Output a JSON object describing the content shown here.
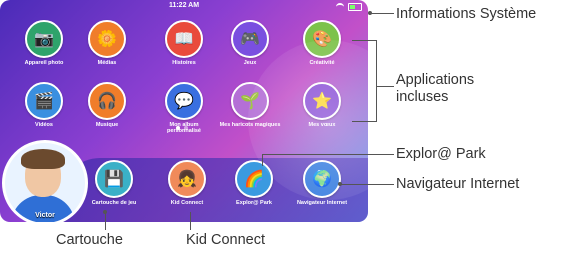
{
  "status": {
    "time": "11:22 AM"
  },
  "apps_row1": [
    {
      "label": "Appareil photo",
      "icon": "camera-icon",
      "glyph": "📷",
      "color": "#2ea36b"
    },
    {
      "label": "Médias",
      "icon": "photo-icon",
      "glyph": "🌼",
      "color": "#f07d2a"
    },
    {
      "label": "Histoires",
      "icon": "book-icon",
      "glyph": "📖",
      "color": "#e94b3c"
    },
    {
      "label": "Jeux",
      "icon": "gamepad-icon",
      "glyph": "🎮",
      "color": "#7a4fe0"
    },
    {
      "label": "Créativité",
      "icon": "palette-icon",
      "glyph": "🎨",
      "color": "#7cc24a"
    }
  ],
  "apps_row2": [
    {
      "label": "Vidéos",
      "icon": "video-icon",
      "glyph": "🎬",
      "color": "#3a8fe0"
    },
    {
      "label": "Musique",
      "icon": "headphones-icon",
      "glyph": "🎧",
      "color": "#f07d2a"
    },
    {
      "label": "Mon album personnalisé",
      "icon": "album-icon",
      "glyph": "💬",
      "color": "#3a6fe0"
    },
    {
      "label": "Mes haricots magiques",
      "icon": "beans-icon",
      "glyph": "🌱",
      "color": "#b46fd6"
    },
    {
      "label": "Mes vœux",
      "icon": "star-icon",
      "glyph": "⭐",
      "color": "#8a4fd6"
    }
  ],
  "tray": [
    {
      "label": "Cartouche de jeu",
      "icon": "cartridge-icon",
      "glyph": "💾",
      "color": "#3ab0c7"
    },
    {
      "label": "Kid Connect",
      "icon": "kid-connect-icon",
      "glyph": "👧",
      "color": "#f08a5a"
    },
    {
      "label": "Explor@ Park",
      "icon": "park-icon",
      "glyph": "🌈",
      "color": "#3a9ae0"
    },
    {
      "label": "Navigateur Internet",
      "icon": "globe-icon",
      "glyph": "🌍",
      "color": "#3a7fe0"
    }
  ],
  "profile": {
    "name": "Victor"
  },
  "callouts": {
    "info": "Informations Système",
    "apps": "Applications incluses",
    "park": "Explor@ Park",
    "browser": "Navigateur Internet",
    "cartridge": "Cartouche",
    "kidconnect": "Kid Connect"
  }
}
